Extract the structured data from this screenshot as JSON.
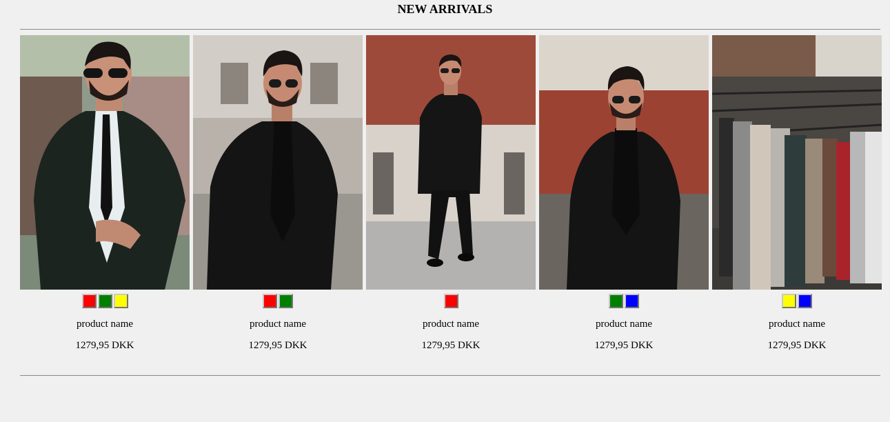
{
  "section_title": "NEW ARRIVALS",
  "products": [
    {
      "name": "product name",
      "price": "1279,95 DKK",
      "image": "man-grey-suit-tie-sunglasses",
      "swatches": [
        "#ff0000",
        "#008000",
        "#ffff00"
      ]
    },
    {
      "name": "product name",
      "price": "1279,95 DKK",
      "image": "man-black-suit-urban",
      "swatches": [
        "#ff0000",
        "#008000"
      ]
    },
    {
      "name": "product name",
      "price": "1279,95 DKK",
      "image": "man-walking-black-suit",
      "swatches": [
        "#ff0000"
      ]
    },
    {
      "name": "product name",
      "price": "1279,95 DKK",
      "image": "man-black-suit-brick-wall",
      "swatches": [
        "#008000",
        "#0000ff"
      ]
    },
    {
      "name": "product name",
      "price": "1279,95 DKK",
      "image": "clothing-rack-sweaters",
      "swatches": [
        "#ffff00",
        "#0000ff"
      ]
    }
  ]
}
